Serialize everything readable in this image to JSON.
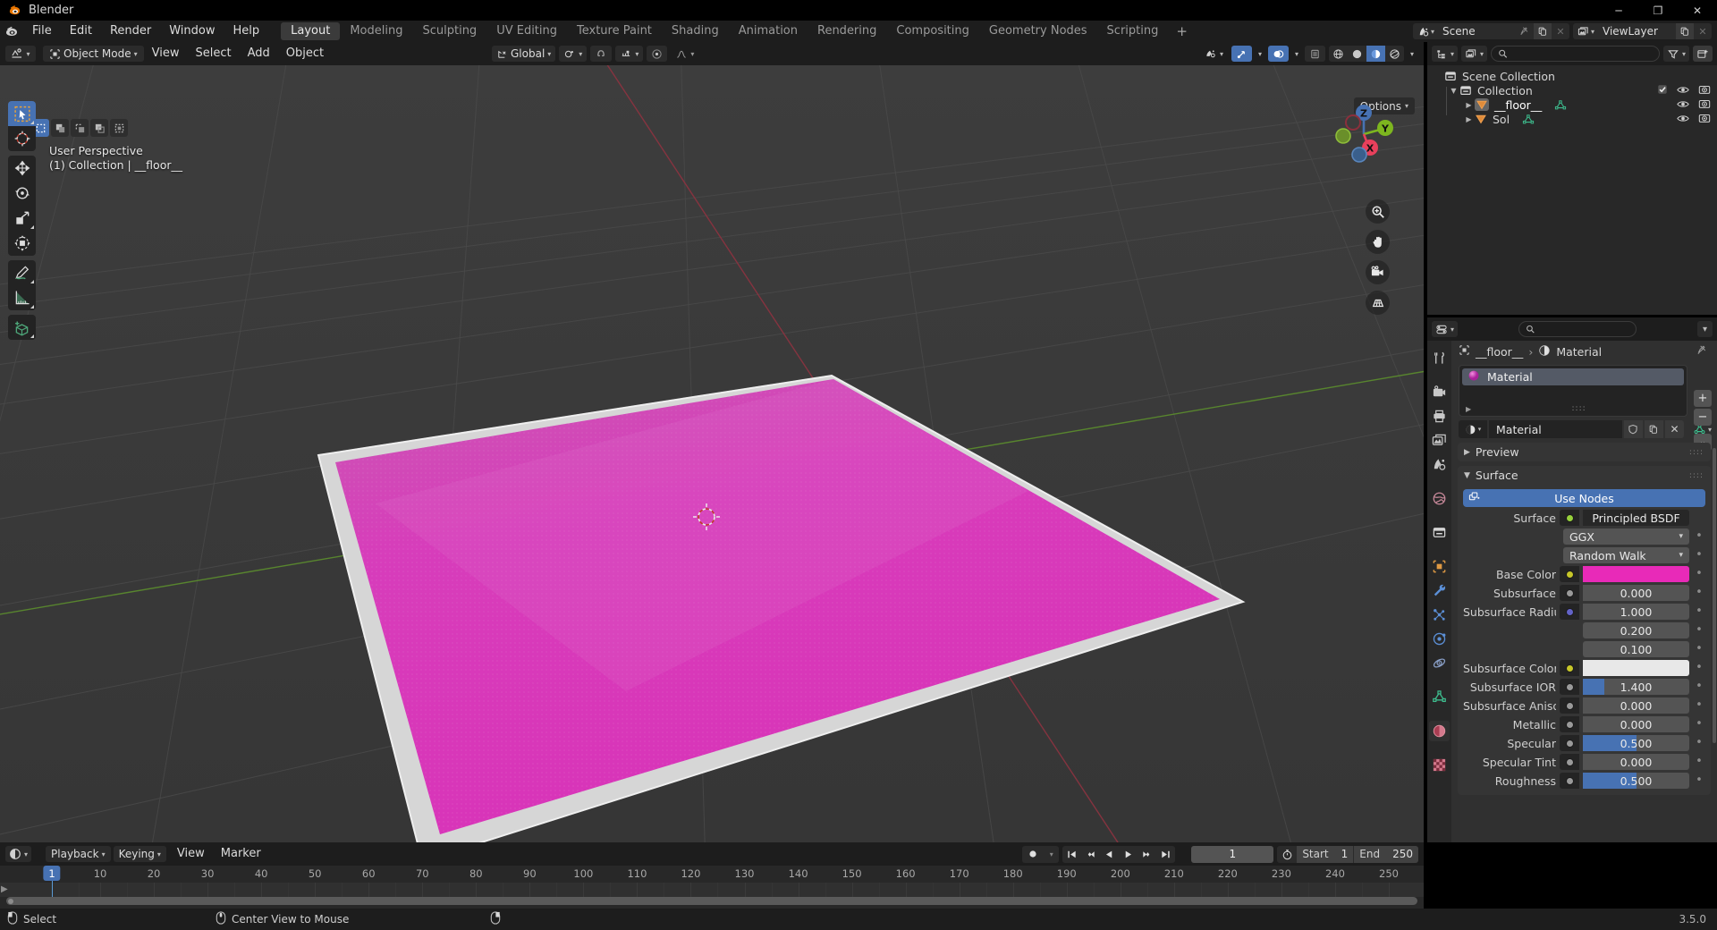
{
  "window": {
    "app_title": "Blender",
    "app_icon": "blender-logo-icon",
    "minimize": "─",
    "maximize": "❐",
    "close": "✕"
  },
  "topbar": {
    "menus": [
      "File",
      "Edit",
      "Render",
      "Window",
      "Help"
    ],
    "workspaces": [
      {
        "label": "Layout",
        "active": true
      },
      {
        "label": "Modeling",
        "active": false
      },
      {
        "label": "Sculpting",
        "active": false
      },
      {
        "label": "UV Editing",
        "active": false
      },
      {
        "label": "Texture Paint",
        "active": false
      },
      {
        "label": "Shading",
        "active": false
      },
      {
        "label": "Animation",
        "active": false
      },
      {
        "label": "Rendering",
        "active": false
      },
      {
        "label": "Compositing",
        "active": false
      },
      {
        "label": "Geometry Nodes",
        "active": false
      },
      {
        "label": "Scripting",
        "active": false
      }
    ],
    "add_workspace": "+",
    "scene": {
      "name": "Scene",
      "icon": "scene-icon",
      "pin": "pin-icon",
      "copy": "new-scene-icon",
      "remove": "✕"
    },
    "view_layer": {
      "name": "ViewLayer",
      "icon": "viewlayer-icon",
      "copy": "new-viewlayer-icon",
      "remove": "✕"
    }
  },
  "viewport": {
    "header": {
      "editor_type": "editor-type-3dview-icon",
      "mode": "Object Mode",
      "menus": [
        "View",
        "Select",
        "Add",
        "Object"
      ],
      "transform_orientation": "Global",
      "options_label": "Options"
    },
    "select_modes": [
      "set",
      "extend",
      "subtract",
      "invert",
      "intersect"
    ],
    "overlay_text_line1": "User Perspective",
    "overlay_text_line2": "(1) Collection | __floor__",
    "gizmo_axes": [
      {
        "label": "Z",
        "color": "#4772b3"
      },
      {
        "label": "Y",
        "color": "#7db61f"
      },
      {
        "label": "X",
        "color": "#e8405c"
      }
    ],
    "nav_buttons": [
      "zoom-icon",
      "pan-hand-icon",
      "camera-view-icon",
      "toggle-perspective-icon"
    ],
    "tools": [
      "tweak-select-box-tool",
      "cursor-tool",
      "move-tool",
      "rotate-tool",
      "scale-tool",
      "transform-tool",
      "annotate-tool",
      "measure-tool",
      "add-cube-tool"
    ],
    "object_color": "#d938b8",
    "outline_color": "#d6d6d6",
    "background_color": "#393939"
  },
  "outliner": {
    "display_mode_icon": "outliner-display-mode-icon",
    "filter_id_icon": "filter-id-icon",
    "search_placeholder": "",
    "filter_icon": "filter-funnel-icon",
    "new_collection_icon": "new-collection-icon",
    "rows": [
      {
        "label": "Scene Collection",
        "icon": "scene-collection-icon",
        "indent": 0,
        "expandable": false,
        "checkbox": false,
        "eye": false,
        "camera": false
      },
      {
        "label": "Collection",
        "icon": "collection-icon",
        "indent": 1,
        "expandable": true,
        "checkbox": true,
        "eye": true,
        "camera": true
      },
      {
        "label": "__floor__",
        "icon": "mesh-object-icon",
        "indent": 2,
        "expandable": true,
        "checkbox": false,
        "eye": true,
        "camera": true,
        "data_icon": "mesh-data-icon",
        "selected": true
      },
      {
        "label": "Sol",
        "icon": "mesh-object-icon",
        "indent": 2,
        "expandable": true,
        "checkbox": false,
        "eye": true,
        "camera": true,
        "data_icon": "mesh-data-icon",
        "selected": false
      }
    ]
  },
  "properties": {
    "editor_type_icon": "editor-type-properties-icon",
    "search_placeholder": "",
    "tabs": [
      {
        "name": "tool",
        "icon": "tool-icon",
        "active": false
      },
      {
        "name": "render",
        "icon": "render-camera-icon",
        "active": false
      },
      {
        "name": "output",
        "icon": "printer-icon",
        "active": false
      },
      {
        "name": "view-layer",
        "icon": "images-icon",
        "active": false
      },
      {
        "name": "scene",
        "icon": "scene-props-icon",
        "active": false
      },
      {
        "name": "world",
        "icon": "world-icon",
        "active": false
      },
      {
        "name": "collection",
        "icon": "collection-props-icon",
        "active": false
      },
      {
        "name": "object",
        "icon": "object-props-icon",
        "active": false
      },
      {
        "name": "modifiers",
        "icon": "wrench-icon",
        "active": false
      },
      {
        "name": "particles",
        "icon": "particles-icon",
        "active": false
      },
      {
        "name": "physics",
        "icon": "physics-icon",
        "active": false
      },
      {
        "name": "constraints",
        "icon": "constraints-icon",
        "active": false
      },
      {
        "name": "data",
        "icon": "mesh-data-icon",
        "active": false
      },
      {
        "name": "material",
        "icon": "material-sphere-icon",
        "active": true
      },
      {
        "name": "texture",
        "icon": "texture-checker-icon",
        "active": false
      }
    ],
    "breadcrumb": {
      "object_icon": "object-props-icon",
      "object": "__floor__",
      "separator": "›",
      "material_icon": "material-sphere-icon",
      "material": "Material",
      "pin_icon": "pin-icon"
    },
    "material_slots": [
      {
        "name": "Material",
        "selected": true,
        "preview_color": "#d938b8"
      }
    ],
    "slot_buttons": [
      "+",
      "−",
      "⌄"
    ],
    "material_datablock": {
      "icon": "material-sphere-icon",
      "name": "Material",
      "shield_icon": "fake-user-icon",
      "copy_icon": "new-material-icon",
      "unlink_icon": "✕",
      "node_icon": "node-tree-icon"
    },
    "panels": [
      {
        "title": "Preview",
        "expanded": false
      },
      {
        "title": "Surface",
        "expanded": true
      }
    ],
    "use_nodes_label": "Use Nodes",
    "surface_rows": [
      {
        "type": "enum",
        "label": "Surface",
        "value": "Principled BSDF",
        "socket": "#97d13c",
        "has_decorator": false
      },
      {
        "type": "dropdown",
        "label": "",
        "value": "GGX",
        "has_decorator": true
      },
      {
        "type": "dropdown",
        "label": "",
        "value": "Random Walk",
        "has_decorator": true
      },
      {
        "type": "color",
        "label": "Base Color",
        "value": "#e82ab8",
        "socket": "#c7c729",
        "has_decorator": true
      },
      {
        "type": "value",
        "label": "Subsurface",
        "value": "0.000",
        "fill": 0.0,
        "socket": "#9a9a9a",
        "has_decorator": true
      },
      {
        "type": "value",
        "label": "Subsurface Radius",
        "value": "1.000",
        "fill": 0.0,
        "socket": "#6363c7",
        "indent": true,
        "has_decorator": true
      },
      {
        "type": "value",
        "label": "",
        "value": "0.200",
        "fill": 0.0,
        "indent": true,
        "has_decorator": true
      },
      {
        "type": "value",
        "label": "",
        "value": "0.100",
        "fill": 0.0,
        "indent": true,
        "has_decorator": true
      },
      {
        "type": "color",
        "label": "Subsurface Color",
        "value": "#e8e8e8",
        "socket": "#c7c729",
        "has_decorator": true
      },
      {
        "type": "value",
        "label": "Subsurface IOR",
        "value": "1.400",
        "fill": 0.2,
        "socket": "#9a9a9a",
        "has_decorator": true
      },
      {
        "type": "value",
        "label": "Subsurface Aniso…",
        "value": "0.000",
        "fill": 0.0,
        "socket": "#9a9a9a",
        "has_decorator": true
      },
      {
        "type": "value",
        "label": "Metallic",
        "value": "0.000",
        "fill": 0.0,
        "socket": "#9a9a9a",
        "has_decorator": true
      },
      {
        "type": "value",
        "label": "Specular",
        "value": "0.500",
        "fill": 0.5,
        "socket": "#9a9a9a",
        "has_decorator": true
      },
      {
        "type": "value",
        "label": "Specular Tint",
        "value": "0.000",
        "fill": 0.0,
        "socket": "#9a9a9a",
        "has_decorator": true
      },
      {
        "type": "value",
        "label": "Roughness",
        "value": "0.500",
        "fill": 0.5,
        "socket": "#9a9a9a",
        "has_decorator": true
      }
    ]
  },
  "timeline": {
    "editor_type_icon": "editor-type-timeline-icon",
    "menus": [
      "Playback",
      "Keying",
      "View",
      "Marker"
    ],
    "record_icon": "auto-keying-icon",
    "transport": [
      "jump-to-start-icon",
      "jump-to-prev-keyframe-icon",
      "play-reverse-icon",
      "play-icon",
      "jump-to-next-keyframe-icon",
      "jump-to-end-icon"
    ],
    "current_frame": "1",
    "timer_icon": "use-preview-range-icon",
    "start_label": "Start",
    "start_value": "1",
    "end_label": "End",
    "end_value": "250",
    "ticks": [
      "1",
      "10",
      "20",
      "30",
      "40",
      "50",
      "60",
      "70",
      "80",
      "90",
      "100",
      "110",
      "120",
      "130",
      "140",
      "150",
      "160",
      "170",
      "180",
      "190",
      "200",
      "210",
      "220",
      "230",
      "240",
      "250"
    ],
    "playhead_frame": "1"
  },
  "statusbar": {
    "hints": [
      {
        "icon": "mouse-left-icon",
        "label": "Select"
      },
      {
        "icon": "mouse-middle-icon",
        "label": "Center View to Mouse"
      },
      {
        "icon": "mouse-right-icon",
        "label": ""
      }
    ],
    "version": "3.5.0"
  }
}
